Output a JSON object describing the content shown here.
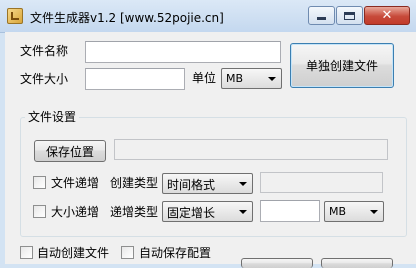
{
  "window": {
    "title": "文件生成器v1.2 [www.52pojie.cn]",
    "minimize_glyph": "",
    "close_glyph": "✕"
  },
  "top": {
    "filename_label": "文件名称",
    "filename_value": "",
    "filesize_label": "文件大小",
    "filesize_value": "",
    "unit_label": "单位",
    "unit_value": "MB",
    "create_single_label": "单独创建文件"
  },
  "settings": {
    "group_title": "文件设置",
    "save_location_label": "保存位置",
    "save_location_value": "",
    "file_increment_label": "文件递增",
    "create_type_label": "创建类型",
    "create_type_value": "时间格式",
    "create_type_extra_value": "",
    "size_increment_label": "大小递增",
    "increment_type_label": "递增类型",
    "increment_type_value": "固定增长",
    "increment_amount_value": "",
    "increment_unit_value": "MB"
  },
  "bottom": {
    "auto_create_label": "自动创建文件",
    "auto_save_label": "自动保存配置"
  }
}
